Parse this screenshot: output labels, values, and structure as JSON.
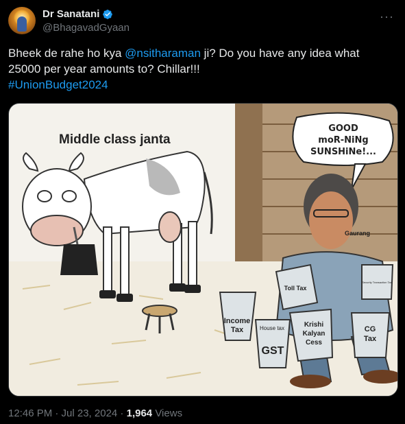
{
  "author": {
    "name": "Dr Sanatani",
    "handle": "@BhagavadGyaan",
    "verified_icon": "verified-badge-icon",
    "avatar_icon": "avatar-image"
  },
  "more_menu": "···",
  "tweet": {
    "text_prefix": "Bheek de rahe ho kya ",
    "mention": "@nsitharaman",
    "text_suffix": " ji? Do you have any idea what 25000 per year amounts to? Chillar!!!",
    "hashtag": "#UnionBudget2024"
  },
  "cartoon": {
    "caption": "Middle class janta",
    "speech_line1": "GOOD",
    "speech_line2": "moR-NiNg",
    "speech_line3": "SUNSHiNe!...",
    "signature": "Gaurang",
    "buckets": {
      "toll": "Toll Tax",
      "income1": "Income",
      "income2": "Tax",
      "house": "House tax",
      "gst": "GST",
      "krishi1": "Krishi",
      "krishi2": "Kalyan",
      "krishi3": "Cess",
      "cg1": "CG",
      "cg2": "Tax",
      "security": "Security Transaction Tax"
    }
  },
  "footer": {
    "time_date": "12:46 PM · Jul 23, 2024 · ",
    "views_count": "1,964",
    "views_label": " Views"
  },
  "colors": {
    "background": "#000000",
    "link": "#1d9bf0",
    "muted": "#71767b",
    "text": "#e7e9ea"
  }
}
